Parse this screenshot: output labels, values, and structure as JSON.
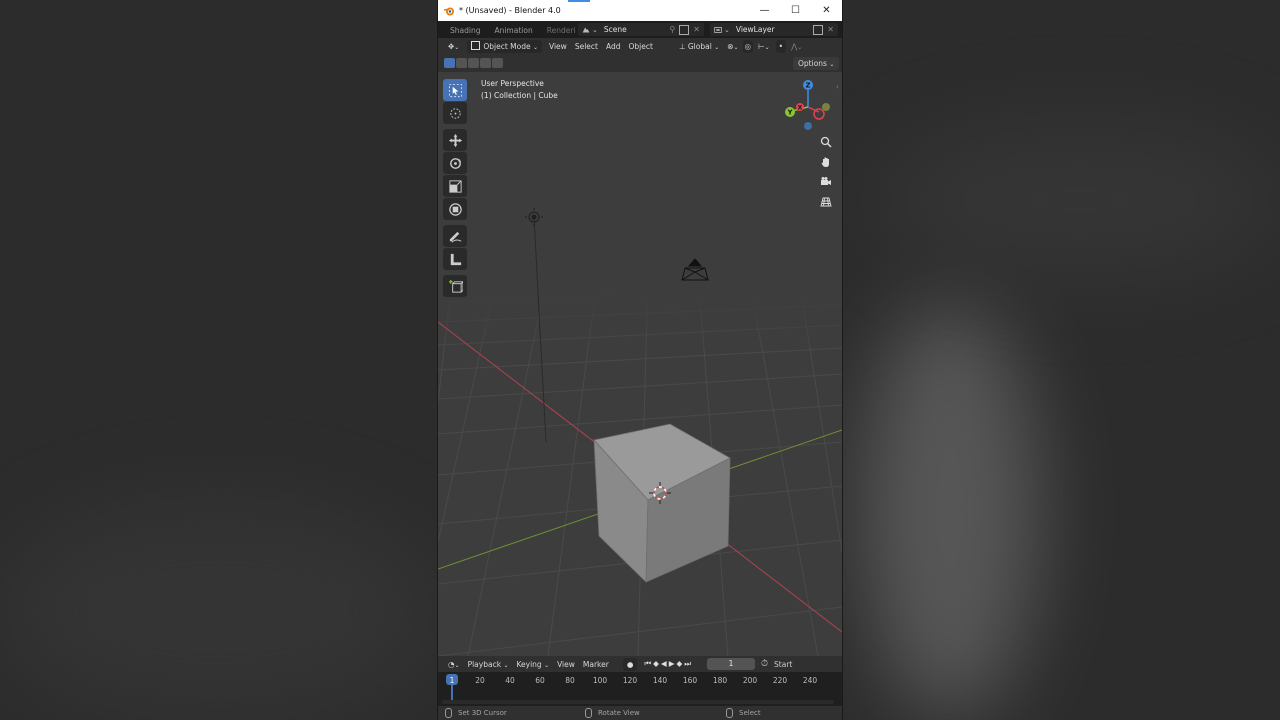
{
  "window": {
    "title": "* (Unsaved) - Blender 4.0",
    "minimize": "—",
    "maximize": "☐",
    "close": "✕"
  },
  "workspaces": {
    "tabs": [
      "Shading",
      "Animation",
      "Rendering"
    ],
    "scene": "Scene",
    "view_layer": "ViewLayer"
  },
  "header": {
    "mode": "Object Mode",
    "menus": [
      "View",
      "Select",
      "Add",
      "Object"
    ],
    "transform_orientation": "Global",
    "options": "Options"
  },
  "viewport": {
    "view_name": "User Perspective",
    "collection_info": "(1) Collection | Cube",
    "axes": {
      "x_color": "#e5414f",
      "y_color": "#8cc534",
      "z_color": "#3d8ee6"
    },
    "gizmo_labels": {
      "x": "X",
      "y": "Y",
      "z": "Z"
    }
  },
  "timeline": {
    "menus": [
      "Playback",
      "Keying",
      "View",
      "Marker"
    ],
    "current_frame": "1",
    "start_label": "Start",
    "frame_ticks": [
      "1",
      "20",
      "40",
      "60",
      "80",
      "100",
      "120",
      "140",
      "160",
      "180",
      "200",
      "220",
      "240"
    ]
  },
  "statusbar": {
    "left": "Set 3D Cursor",
    "middle": "Rotate View",
    "right": "Select"
  },
  "colors": {
    "accent": "#4772b3",
    "viewport_bg": "#3d3d3d",
    "panel_bg": "#303030"
  }
}
